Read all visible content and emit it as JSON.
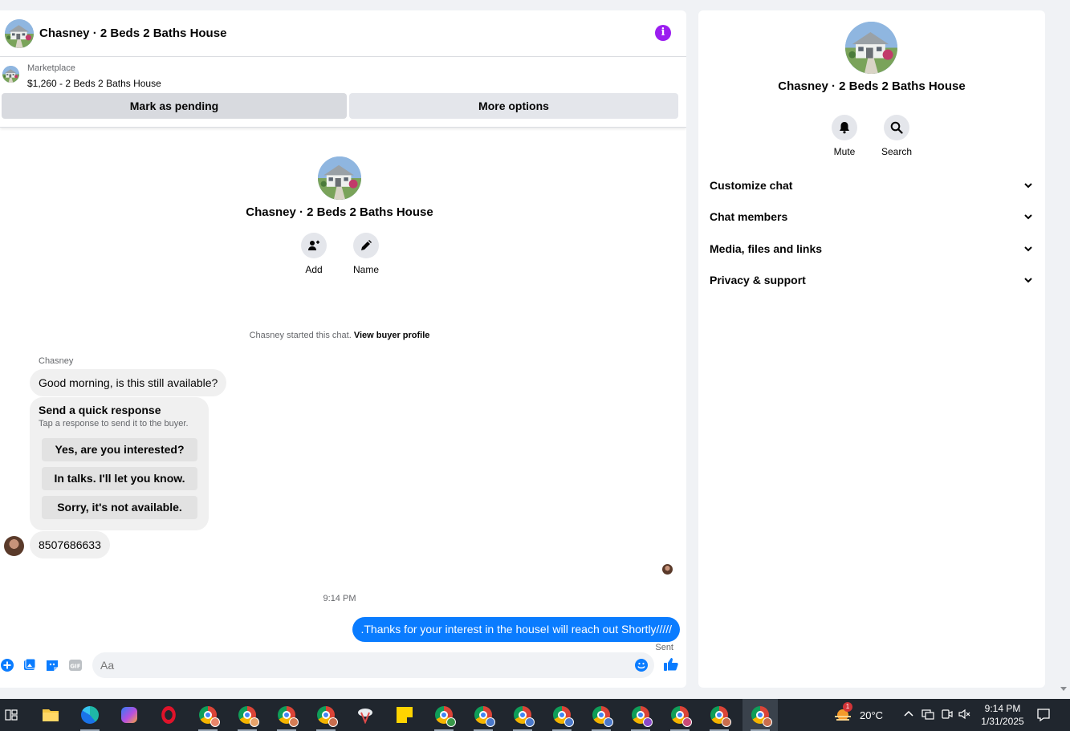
{
  "conversation": {
    "title": "Chasney · 2 Beds 2 Baths House"
  },
  "listing": {
    "source": "Marketplace",
    "title": "$1,260 - 2 Beds 2 Baths House",
    "actions": {
      "pending": "Mark as pending",
      "more": "More options"
    }
  },
  "thread": {
    "title": "Chasney · 2 Beds 2 Baths House",
    "actions": {
      "add": "Add",
      "name": "Name"
    },
    "started_text": "Chasney started this chat.",
    "view_profile": "View buyer profile",
    "sender": "Chasney",
    "message_1": "Good morning, is this still available?",
    "quick_response": {
      "title": "Send a quick response",
      "subtitle": "Tap a response to send it to the buyer.",
      "options": [
        "Yes, are you interested?",
        "In talks. I'll let you know.",
        "Sorry, it's not available."
      ]
    },
    "message_2": "8507686633",
    "timestamp": "9:14 PM",
    "outgoing": ".Thanks for your interest in the houseI will reach out Shortly/////",
    "status": "Sent"
  },
  "composer": {
    "placeholder": "Aa"
  },
  "info_panel": {
    "title": "Chasney · 2 Beds 2 Baths House",
    "actions": {
      "mute": "Mute",
      "search": "Search"
    },
    "sections": [
      "Customize chat",
      "Chat members",
      "Media, files and links",
      "Privacy & support"
    ]
  },
  "taskbar": {
    "weather": {
      "temp": "20°C",
      "alerts": "1"
    },
    "clock": {
      "time": "9:14 PM",
      "date": "1/31/2025"
    }
  },
  "colors": {
    "accent": "#0a7cff",
    "info": "#9b1ef0"
  }
}
